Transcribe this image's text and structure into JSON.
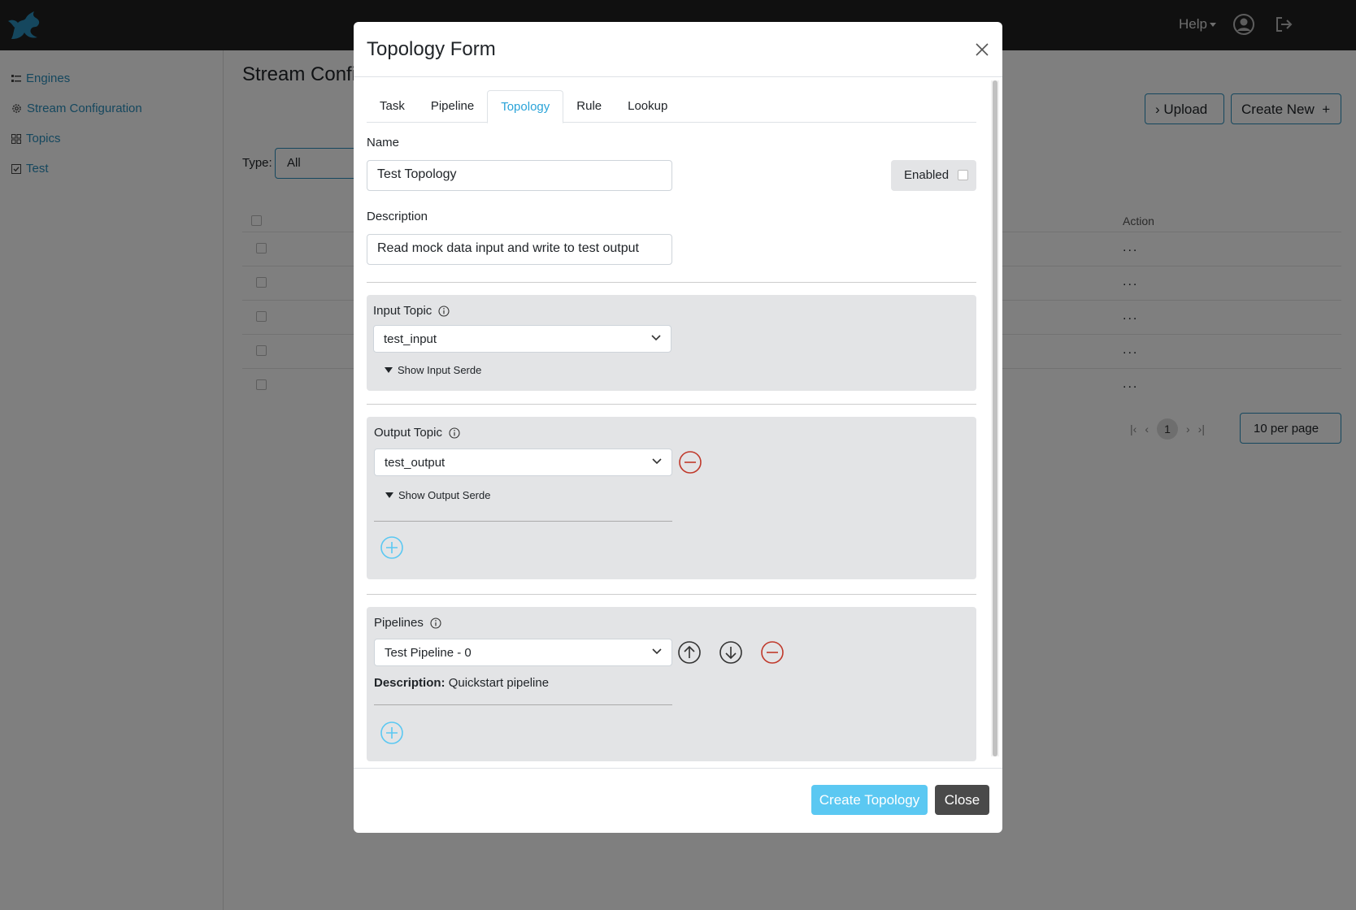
{
  "app": {
    "help_label": "Help",
    "colors": {
      "accent": "#2a8fbd",
      "tab_active": "#2aa3d8",
      "danger": "#c0392b",
      "add": "#5bc8f2"
    }
  },
  "sidebar": {
    "items": [
      {
        "label": "Engines",
        "icon": "engines-icon"
      },
      {
        "label": "Stream Configuration",
        "icon": "gear-icon"
      },
      {
        "label": "Topics",
        "icon": "grid-icon"
      },
      {
        "label": "Test",
        "icon": "checkbox-icon"
      }
    ]
  },
  "page": {
    "title": "Stream Confi",
    "type_label": "Type:",
    "type_value": "All",
    "upload_label": "Upload",
    "create_new_label": "Create New",
    "action_header": "Action",
    "row_actions": [
      "...",
      "...",
      "...",
      "...",
      "..."
    ],
    "current_page": "1",
    "per_page": "10 per page"
  },
  "modal": {
    "title": "Topology Form",
    "tabs": [
      "Task",
      "Pipeline",
      "Topology",
      "Rule",
      "Lookup"
    ],
    "active_tab": "Topology",
    "name_label": "Name",
    "name_value": "Test Topology",
    "enabled_label": "Enabled",
    "description_label": "Description",
    "description_value": "Read mock data input and write to test output",
    "input_topic": {
      "label": "Input Topic",
      "value": "test_input",
      "serde_toggle": "Show Input Serde"
    },
    "output_topic": {
      "label": "Output Topic",
      "value": "test_output",
      "serde_toggle": "Show Output Serde"
    },
    "pipelines": {
      "label": "Pipelines",
      "value": "Test Pipeline - 0",
      "description_key": "Description:",
      "description_value": "Quickstart pipeline"
    },
    "footer": {
      "create_label": "Create Topology",
      "close_label": "Close"
    }
  }
}
